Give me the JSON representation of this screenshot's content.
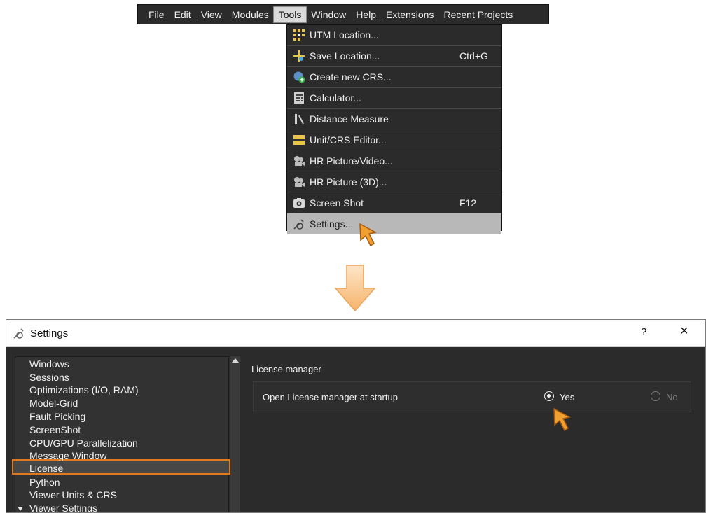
{
  "menubar": {
    "items": [
      {
        "label": "File"
      },
      {
        "label": "Edit"
      },
      {
        "label": "View"
      },
      {
        "label": "Modules"
      },
      {
        "label": "Tools"
      },
      {
        "label": "Window"
      },
      {
        "label": "Help"
      },
      {
        "label": "Extensions"
      },
      {
        "label": "Recent Projects"
      }
    ],
    "active": "Tools"
  },
  "tools_menu": {
    "items": [
      {
        "label": "UTM Location...",
        "icon": "utm-grid-icon",
        "shortcut": ""
      },
      {
        "label": "Save Location...",
        "icon": "save-location-icon",
        "shortcut": "Ctrl+G"
      },
      {
        "label": "Create new CRS...",
        "icon": "globe-plus-icon",
        "shortcut": ""
      },
      {
        "label": "Calculator...",
        "icon": "calculator-icon",
        "shortcut": ""
      },
      {
        "label": "Distance Measure",
        "icon": "ruler-icon",
        "shortcut": ""
      },
      {
        "label": "Unit/CRS Editor...",
        "icon": "unit-crs-icon",
        "shortcut": ""
      },
      {
        "label": "HR Picture/Video...",
        "icon": "film-reel-icon",
        "shortcut": ""
      },
      {
        "label": "HR Picture (3D)...",
        "icon": "film-reel-icon",
        "shortcut": ""
      },
      {
        "label": "Screen Shot",
        "icon": "camera-icon",
        "shortcut": "F12"
      },
      {
        "label": "Settings...",
        "icon": "wrench-icon",
        "shortcut": ""
      }
    ],
    "highlighted": "Settings..."
  },
  "settings_window": {
    "title": "Settings",
    "help": "?",
    "close": "×",
    "tree": [
      {
        "label": "Windows"
      },
      {
        "label": "Sessions"
      },
      {
        "label": "Optimizations (I/O, RAM)"
      },
      {
        "label": "Model-Grid"
      },
      {
        "label": "Fault Picking"
      },
      {
        "label": "ScreenShot"
      },
      {
        "label": "CPU/GPU Parallelization"
      },
      {
        "label": "Message Window"
      },
      {
        "label": "License"
      },
      {
        "label": "Python"
      },
      {
        "label": "Viewer Units & CRS"
      },
      {
        "label": "Viewer Settings"
      }
    ],
    "selected": "License",
    "section_heading": "License manager",
    "option_label": "Open License manager at startup",
    "option_yes": "Yes",
    "option_no": "No",
    "option_value": "Yes"
  },
  "colors": {
    "accent_orange": "#e07b1f",
    "menu_bg": "#2b2b2b",
    "highlight": "#b8b8b8"
  }
}
